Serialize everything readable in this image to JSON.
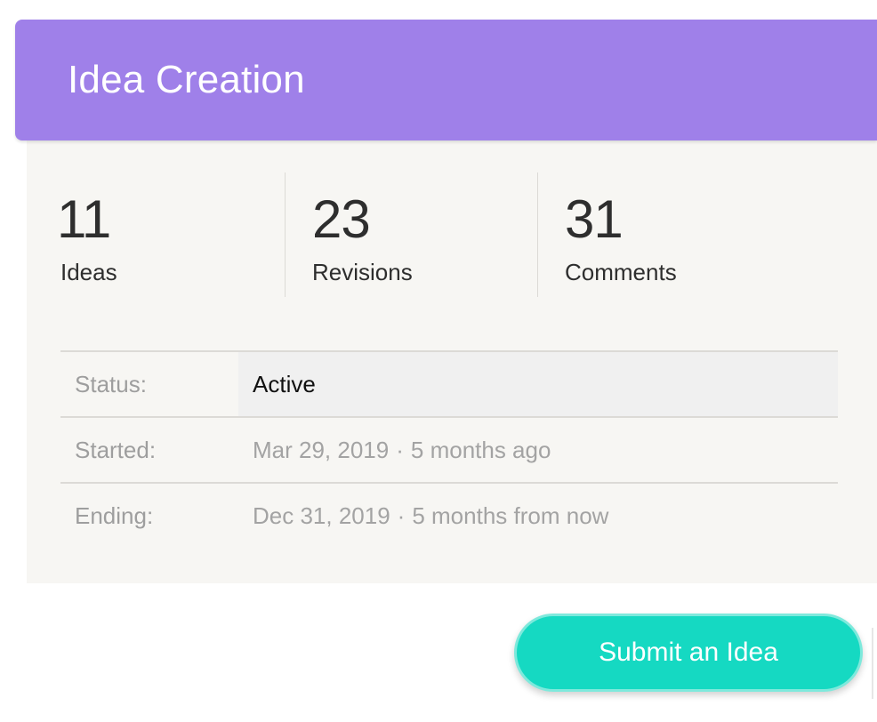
{
  "header": {
    "title": "Idea Creation",
    "background_color": "#9f80e9"
  },
  "stats": [
    {
      "value": "11",
      "label": "Ideas"
    },
    {
      "value": "23",
      "label": "Revisions"
    },
    {
      "value": "31",
      "label": "Comments"
    }
  ],
  "details": {
    "status": {
      "label": "Status:",
      "value": "Active"
    },
    "started": {
      "label": "Started:",
      "date": "Mar 29, 2019",
      "separator": "·",
      "relative": "5 months ago"
    },
    "ending": {
      "label": "Ending:",
      "date": "Dec 31, 2019",
      "separator": "·",
      "relative": "5 months from now"
    }
  },
  "actions": {
    "submit_label": "Submit an Idea",
    "submit_color": "#15d9c2"
  }
}
